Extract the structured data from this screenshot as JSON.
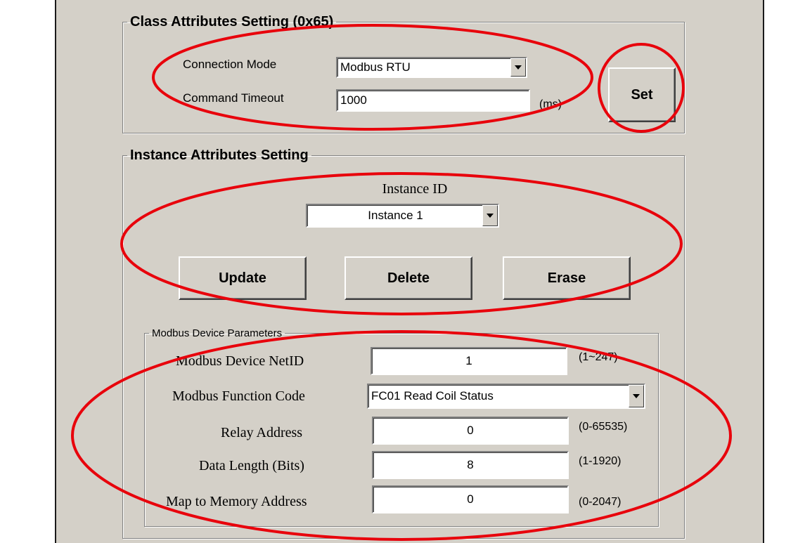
{
  "class_group": {
    "legend": "Class Attributes Setting (0x65)",
    "connection_mode_label": "Connection Mode",
    "connection_mode_value": "Modbus RTU",
    "command_timeout_label": "Command Timeout",
    "command_timeout_value": "1000",
    "timeout_unit": "(ms)",
    "set_button": "Set"
  },
  "instance_group": {
    "legend": "Instance Attributes Setting",
    "instance_id_label": "Instance ID",
    "instance_id_value": "Instance 1",
    "update_button": "Update",
    "delete_button": "Delete",
    "erase_button": "Erase"
  },
  "device_params": {
    "legend": "Modbus Device Parameters",
    "netid_label": "Modbus Device NetID",
    "netid_value": "1",
    "netid_range": "(1~247)",
    "function_code_label": "Modbus Function Code",
    "function_code_value": "FC01 Read Coil Status",
    "relay_address_label": "Relay Address",
    "relay_address_value": "0",
    "relay_address_range": "(0-65535)",
    "data_length_label": "Data Length (Bits)",
    "data_length_value": "8",
    "data_length_range": "(1-1920)",
    "memory_address_label": "Map to Memory Address",
    "memory_address_value": "0",
    "memory_address_range": "(0-2047)"
  },
  "colors": {
    "panel_bg": "#d4d0c8",
    "annotation_red": "#e8000b"
  },
  "icons": {
    "dropdown": "chevron-down-icon"
  }
}
